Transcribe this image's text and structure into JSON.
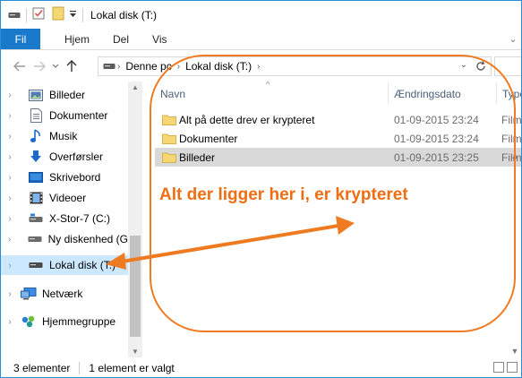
{
  "window": {
    "title": "Lokal disk (T:)"
  },
  "ribbon": {
    "tabs": [
      "Fil",
      "Hjem",
      "Del",
      "Vis"
    ]
  },
  "address": {
    "crumbs": [
      "Denne pc",
      "Lokal disk (T:)"
    ]
  },
  "navpane": {
    "items": [
      {
        "label": "Billeder",
        "icon": "pictures-icon"
      },
      {
        "label": "Dokumenter",
        "icon": "documents-icon"
      },
      {
        "label": "Musik",
        "icon": "music-icon"
      },
      {
        "label": "Overførsler",
        "icon": "downloads-icon"
      },
      {
        "label": "Skrivebord",
        "icon": "desktop-icon"
      },
      {
        "label": "Videoer",
        "icon": "videos-icon"
      },
      {
        "label": "X-Stor-7 (C:)",
        "icon": "drive-icon"
      },
      {
        "label": "Ny diskenhed (G",
        "icon": "drive-icon"
      },
      {
        "label": "Lokal disk (T:)",
        "icon": "drive-icon"
      },
      {
        "label": "Netværk",
        "icon": "network-icon"
      },
      {
        "label": "Hjemmegruppe",
        "icon": "homegroup-icon"
      }
    ]
  },
  "columns": {
    "name": "Navn",
    "date": "Ændringsdato",
    "type": "Type"
  },
  "files": [
    {
      "name": "Alt på dette drev er krypteret",
      "date": "01-09-2015 23:24",
      "type": "Filmappe"
    },
    {
      "name": "Dokumenter",
      "date": "01-09-2015 23:24",
      "type": "Filmappe"
    },
    {
      "name": "Billeder",
      "date": "01-09-2015 23:25",
      "type": "Filmappe"
    }
  ],
  "status": {
    "count": "3 elementer",
    "selected": "1 element er valgt"
  },
  "annotation": {
    "text": "Alt der ligger her i, er krypteret",
    "color": "#ee6e14"
  },
  "colors": {
    "accent": "#1979ca",
    "selection": "#cce8ff",
    "folder": "#f7d774"
  }
}
